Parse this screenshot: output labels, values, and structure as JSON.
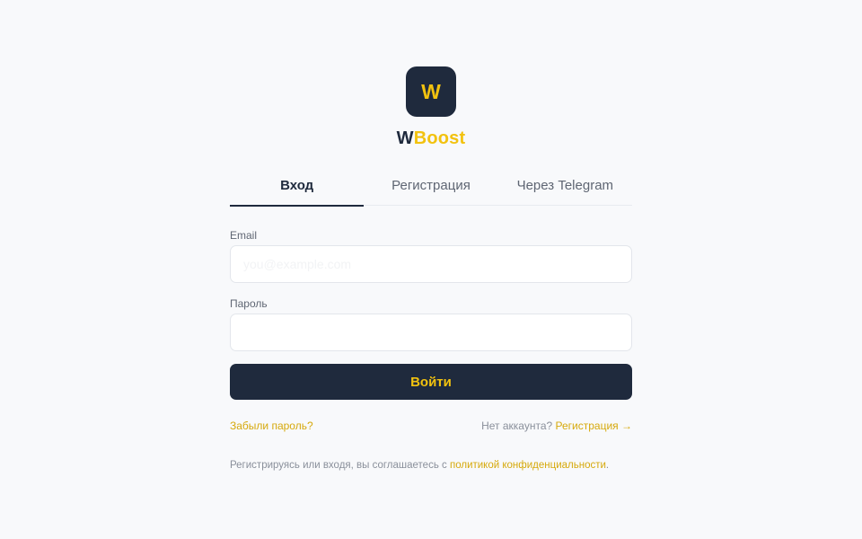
{
  "logo": {
    "letter": "W"
  },
  "brand": {
    "part1": "W",
    "part2": "Boost"
  },
  "tabs": [
    {
      "label": "Вход",
      "active": true
    },
    {
      "label": "Регистрация",
      "active": false
    },
    {
      "label": "Через Telegram",
      "active": false
    }
  ],
  "form": {
    "email": {
      "label": "Email",
      "value": "",
      "placeholder": "you@example.com"
    },
    "password": {
      "label": "Пароль",
      "value": "",
      "placeholder": ""
    },
    "submit_label": "Войти"
  },
  "links": {
    "forgot": "Забыли пароль?",
    "no_account": "Нет аккаунта?",
    "register": "Регистрация →"
  },
  "terms": {
    "text": "Регистрируясь или входя, вы соглашаетесь с",
    "link": "политикой конфиденциальности",
    "end": "."
  },
  "colors": {
    "background": "#f8f9fb",
    "navy": "#1f2a3d",
    "accent": "#f2c20f",
    "link": "#d6a90c",
    "muted": "#8a909b"
  }
}
